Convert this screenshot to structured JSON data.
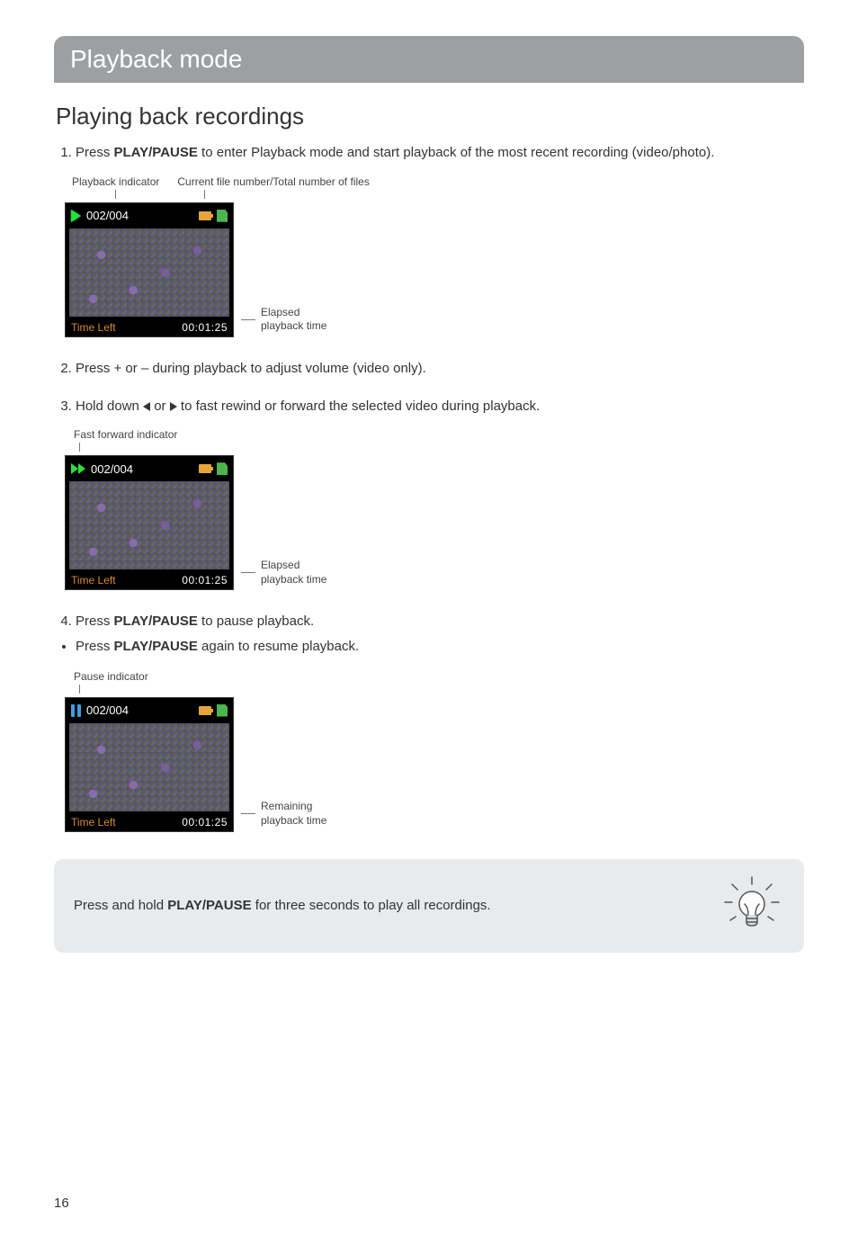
{
  "header": "Playback mode",
  "section_title": "Playing back recordings",
  "step1": {
    "num": "1.",
    "prefix": "Press ",
    "button": "PLAY/PAUSE",
    "suffix": " to enter Playback mode and start playback of the most recent recording (video/photo)."
  },
  "callouts1": {
    "left": "Playback indicator",
    "right": "Current file number/Total number of files"
  },
  "screen": {
    "file_count": "002/004",
    "time_left_label": "Time Left",
    "time_left_value": "00:01:25"
  },
  "side1": "Elapsed\nplayback time",
  "step2": {
    "num": "2.",
    "text": "Press + or – during playback to adjust volume (video only)."
  },
  "step3": {
    "num": "3.",
    "prefix": "Hold down ",
    "mid": " or ",
    "suffix": " to fast rewind or forward the selected video during playback."
  },
  "callout2": "Fast forward indicator",
  "side2": "Elapsed\nplayback time",
  "step4": {
    "num": "4.",
    "prefix": "Press ",
    "button": "PLAY/PAUSE",
    "suffix": " to pause playback."
  },
  "bullet1": {
    "prefix": "Press ",
    "button": "PLAY/PAUSE",
    "suffix": " again to resume playback."
  },
  "callout3": "Pause indicator",
  "side3": "Remaining\nplayback time",
  "tip": {
    "prefix": "Press and hold ",
    "button": "PLAY/PAUSE",
    "suffix": " for three seconds to play all recordings."
  },
  "page_number": "16"
}
